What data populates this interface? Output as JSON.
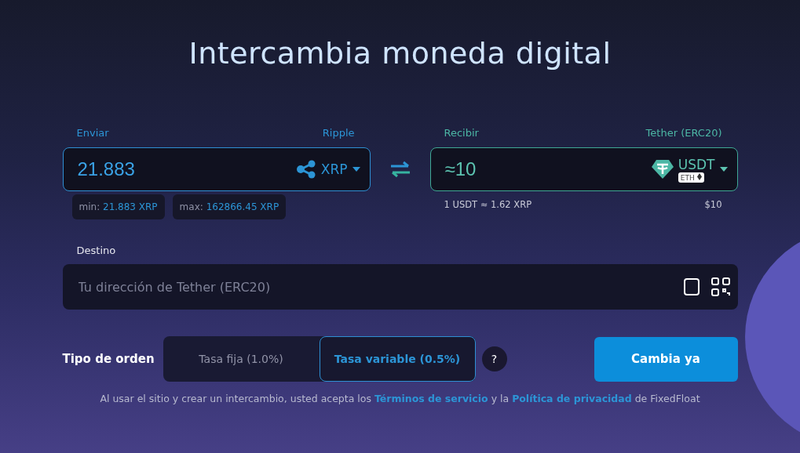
{
  "title": "Intercambia moneda digital",
  "send": {
    "label": "Enviar",
    "currency_name": "Ripple",
    "value": "21.883",
    "ticker": "XRP",
    "min_label": "min:",
    "min_value": "21.883 XRP",
    "max_label": "max:",
    "max_value": "162866.45 XRP"
  },
  "receive": {
    "label": "Recibir",
    "currency_name": "Tether (ERC20)",
    "value": "≈10",
    "ticker": "USDT",
    "network": "ETH",
    "rate": "1 USDT ≈ 1.62 XRP",
    "usd_value": "$10"
  },
  "destination": {
    "label": "Destino",
    "placeholder": "Tu dirección de Tether (ERC20)"
  },
  "order": {
    "label": "Tipo de orden",
    "types": [
      {
        "label": "Tasa fija (1.0%)",
        "selected": false
      },
      {
        "label": "Tasa variable (0.5%)",
        "selected": true
      }
    ],
    "help": "?",
    "submit": "Cambia ya"
  },
  "notice": {
    "before": "Al usar el sitio y crear un intercambio, usted acepta los",
    "link_terms": "Términos de servicio",
    "middle": "y la",
    "link_privacy": "Política de privacidad",
    "after": "de FixedFloat"
  }
}
